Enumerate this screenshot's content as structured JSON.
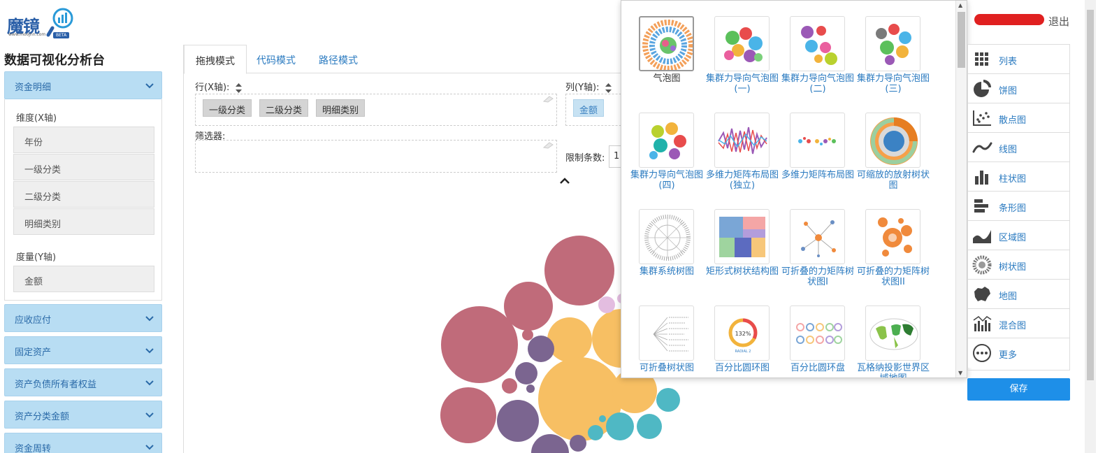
{
  "brand": {
    "logo_text": "魔镜",
    "logo_url": "www.moojnn.com",
    "beta": "BETA"
  },
  "app_title": "数据可视化分析台",
  "sidebar": {
    "sections": [
      {
        "label": "资金明细",
        "expanded": true
      },
      {
        "label": "应收应付"
      },
      {
        "label": "固定资产"
      },
      {
        "label": "资产负债所有者权益"
      },
      {
        "label": "资产分类金额"
      },
      {
        "label": "资金周转"
      }
    ],
    "dimension_title": "维度(X轴)",
    "dimensions": [
      "年份",
      "一级分类",
      "二级分类",
      "明细类别"
    ],
    "measure_title": "度量(Y轴)",
    "measures": [
      "金额"
    ]
  },
  "tabs": [
    "拖拽模式",
    "代码模式",
    "路径模式"
  ],
  "builder": {
    "row_label": "行(X轴):",
    "row_pills": [
      "一级分类",
      "二级分类",
      "明细类别"
    ],
    "col_label": "列(Y轴):",
    "col_pills": [
      "金额"
    ],
    "filter_label": "筛选器:",
    "limit_label": "限制条数:",
    "limit_value": "1"
  },
  "chart_picker": {
    "items": [
      "气泡图",
      "集群力导向气泡图(一)",
      "集群力导向气泡图(二)",
      "集群力导向气泡图(三)",
      "集群力导向气泡图(四)",
      "多维力矩阵布局图(独立)",
      "多维力矩阵布局图",
      "可缩放的放射树状图",
      "集群系统树图",
      "矩形式树状结构图",
      "可折叠的力矩阵树状图I",
      "可折叠的力矩阵树状图II",
      "可折叠树状图",
      "百分比圆环图",
      "百分比圆环盘",
      "瓦格纳投影世界区域地图"
    ],
    "thumb_percent_label": "132%",
    "thumb_radial_label": "RADIAL 2"
  },
  "user": {
    "logout": "退出"
  },
  "chart_types": [
    {
      "label": "列表",
      "icon": "grid-icon"
    },
    {
      "label": "饼图",
      "icon": "pie-icon"
    },
    {
      "label": "散点图",
      "icon": "scatter-icon"
    },
    {
      "label": "线图",
      "icon": "line-icon"
    },
    {
      "label": "柱状图",
      "icon": "bar-icon"
    },
    {
      "label": "条形图",
      "icon": "hbar-icon"
    },
    {
      "label": "区域图",
      "icon": "area-icon"
    },
    {
      "label": "树状图",
      "icon": "tree-icon"
    },
    {
      "label": "地图",
      "icon": "map-icon"
    },
    {
      "label": "混合图",
      "icon": "combo-icon"
    },
    {
      "label": "更多",
      "icon": "more-icon"
    }
  ],
  "save_label": "保存",
  "colors": {
    "accent": "#1e8fe8",
    "accordion": "#b8ddf3",
    "link": "#2a7ac0",
    "bubble_red": "#c06b7a",
    "bubble_orange": "#f7bf63",
    "bubble_purple": "#7b6590",
    "bubble_teal": "#4fb8c4",
    "bubble_pink": "#e3bde0"
  }
}
